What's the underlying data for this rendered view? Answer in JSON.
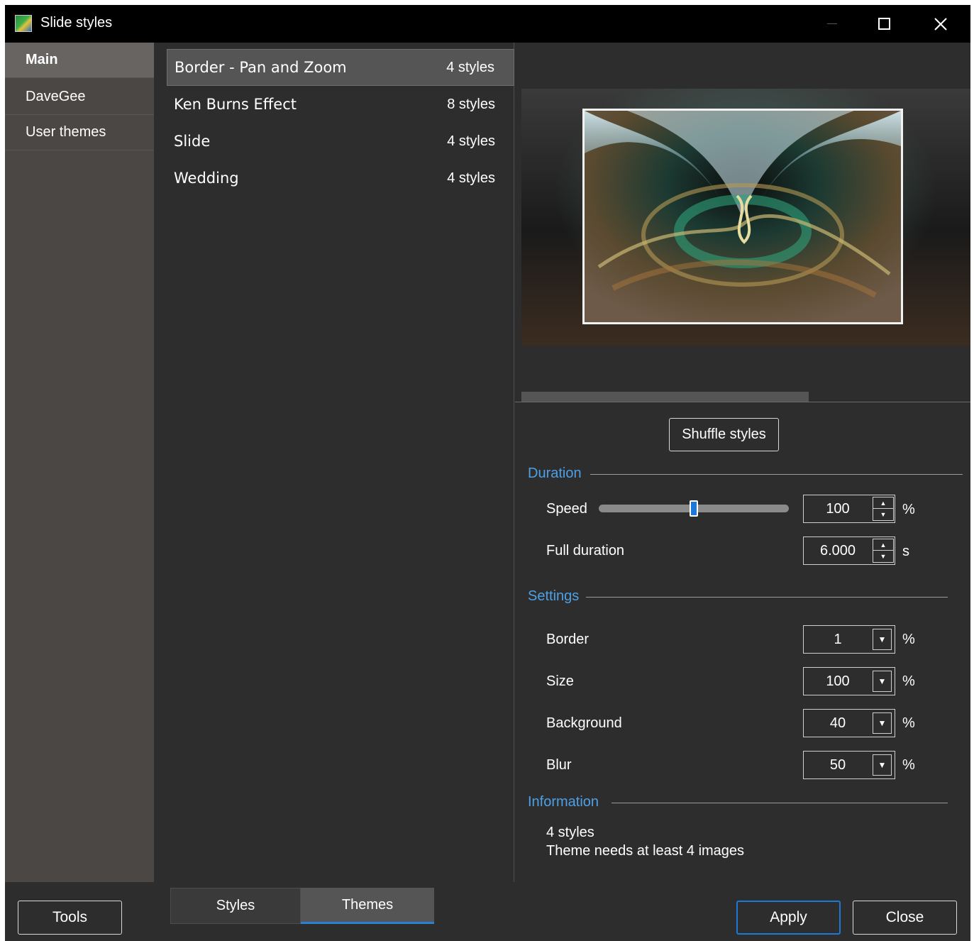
{
  "window": {
    "title": "Slide styles",
    "icon": "app-icon",
    "controls": {
      "minimize": "—",
      "maximize": "☐",
      "close": "✕"
    }
  },
  "sidebar": {
    "items": [
      {
        "label": "Main",
        "active": true
      },
      {
        "label": "DaveGee",
        "active": false
      },
      {
        "label": "User themes",
        "active": false
      }
    ]
  },
  "themes": [
    {
      "name": "Border - Pan and Zoom",
      "count": "4 styles",
      "selected": true
    },
    {
      "name": "Ken Burns Effect",
      "count": "8 styles",
      "selected": false
    },
    {
      "name": "Slide",
      "count": "4 styles",
      "selected": false
    },
    {
      "name": "Wedding",
      "count": "4 styles",
      "selected": false
    }
  ],
  "preview": {
    "scroll_position": 0.0,
    "scroll_visible_fraction": 0.64
  },
  "settings": {
    "shuffle_label": "Shuffle styles",
    "duration": {
      "title": "Duration",
      "speed_label": "Speed",
      "speed_slider_fraction": 0.5,
      "speed_value": "100",
      "speed_unit": "%",
      "full_duration_label": "Full duration",
      "full_duration_value": "6.000",
      "full_duration_unit": "s"
    },
    "settings_group": {
      "title": "Settings",
      "fields": [
        {
          "label": "Border",
          "value": "1",
          "unit": "%"
        },
        {
          "label": "Size",
          "value": "100",
          "unit": "%"
        },
        {
          "label": "Background",
          "value": "40",
          "unit": "%"
        },
        {
          "label": "Blur",
          "value": "50",
          "unit": "%"
        }
      ]
    },
    "information": {
      "title": "Information",
      "lines": [
        "4 styles",
        "Theme needs at least 4 images"
      ]
    }
  },
  "bottom": {
    "tools_label": "Tools",
    "tabs": [
      {
        "label": "Styles",
        "active": false
      },
      {
        "label": "Themes",
        "active": true
      }
    ],
    "apply_label": "Apply",
    "close_label": "Close"
  },
  "colors": {
    "accent": "#4ea0e6",
    "focus": "#1e78d6",
    "background": "#2d2d2d",
    "sidebar": "#4a4745"
  }
}
